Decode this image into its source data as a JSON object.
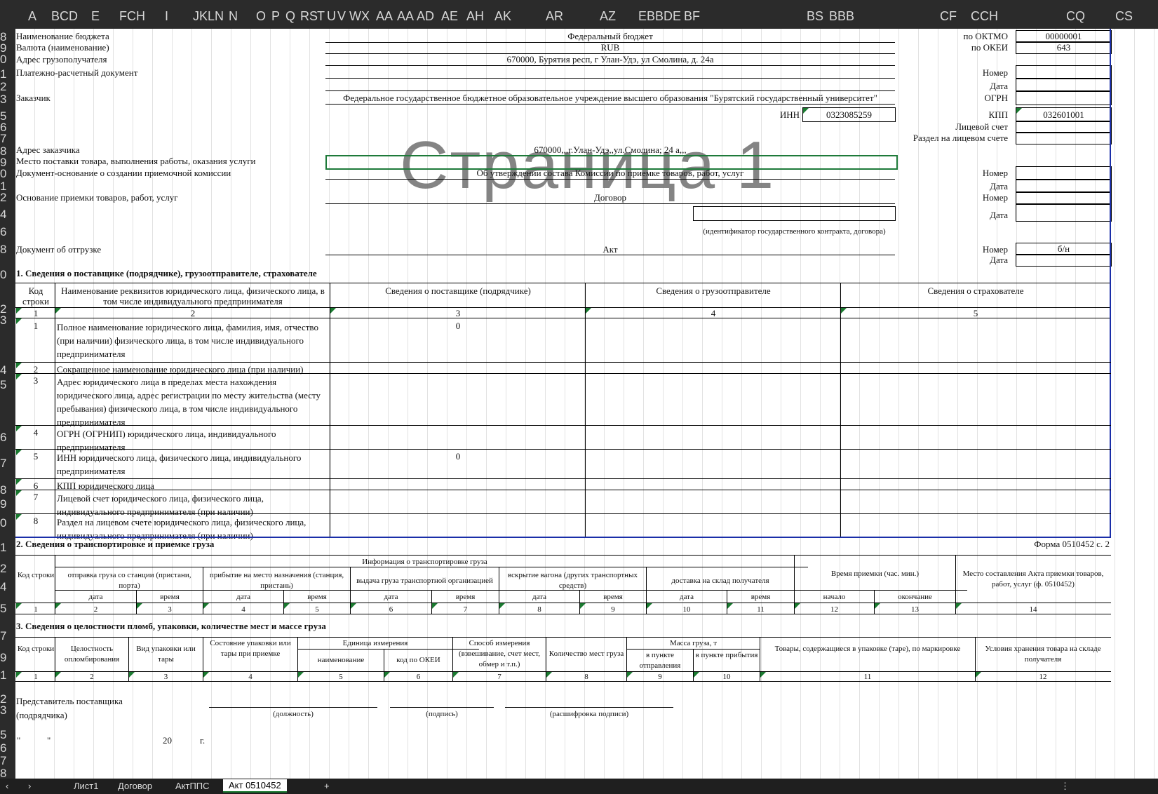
{
  "column_headers": [
    "A",
    "BCD",
    "E",
    "FCH",
    "I",
    "JKLN",
    "N",
    "O",
    "P",
    "Q",
    "RS",
    "T",
    "U",
    "V",
    "WX",
    "AA",
    "AA",
    "AD",
    "AE",
    "AH",
    "AK",
    "AR",
    "AZ",
    "EBBDE",
    "BF",
    "BS",
    "BBB",
    "CF",
    "CCH",
    "CQ",
    "CS"
  ],
  "row_numbers": [
    "8",
    "9",
    "0",
    "1",
    "2",
    "3",
    "5",
    "6",
    "7",
    "8",
    "9",
    "0",
    "1",
    "2",
    "4",
    "6",
    "8",
    "0",
    "2",
    "3",
    "4",
    "5",
    "6",
    "7",
    "8",
    "9",
    "0",
    "1",
    "2",
    "4",
    "5",
    "7",
    "9",
    "1",
    "2",
    "3",
    "5",
    "6",
    "7",
    "8"
  ],
  "watermark": "Страница 1",
  "header": {
    "budget_label": "Наименование бюджета",
    "budget_value": "Федеральный бюджет",
    "oktmo_label": "по ОКТМО",
    "oktmo_value": "00000001",
    "currency_label": "Валюта (наименование)",
    "currency_value": "RUB",
    "okei_label": "по ОКЕИ",
    "okei_value": "643",
    "consignee_address_label": "Адрес грузополучателя",
    "consignee_address_value": "670000, Бурятия респ, г Улан-Удэ, ул Смолина, д. 24а",
    "payment_doc_label": "Платежно-расчетный документ",
    "nomer_label": "Номер",
    "data_label": "Дата",
    "customer_label": "Заказчик",
    "customer_value": "Федеральное государственное бюджетное образовательное учреждение высшего образования \"Бурятский государственный университет\"",
    "ogrn_label": "ОГРН",
    "inn_label": "ИНН",
    "inn_value": "0323085259",
    "kpp_label": "КПП",
    "kpp_value": "032601001",
    "account_label": "Лицевой счет",
    "account_section_label": "Раздел на лицевом счете",
    "customer_address_label": "Адрес заказчика",
    "customer_address_value": "670000,,,г.Улан-Удэ,,ул.Смолина; 24 а,,,",
    "delivery_place_label": "Место поставки товара, выполнения работы, оказания услуги",
    "commission_doc_label": "Документ-основание о создании приемочной комиссии",
    "commission_doc_value": "Об утверждении состава Комиссии по приемке товаров, работ, услуг",
    "basis_label": "Основание приемки товаров, работ, услуг",
    "basis_value": "Договор",
    "contract_id_caption": "(идентификатор государственного контракта, договора)",
    "shipment_doc_label": "Документ об отгрузке",
    "shipment_doc_value": "Акт",
    "shipment_nomer_value": "б/н"
  },
  "section1": {
    "title": "1. Сведения о поставщике (подрядчике), грузоотправителе, страхователе",
    "col_code": "Код строки",
    "col_name": "Наименование реквизитов юридического лица, физического лица, в том числе индивидуального предпринимателя",
    "col_supplier": "Сведения о поставщике (подрядчике)",
    "col_shipper": "Сведения о грузоотправителе",
    "col_insurer": "Сведения о страхователе",
    "col_numbers": [
      "1",
      "2",
      "3",
      "4",
      "5"
    ],
    "rows": [
      {
        "code": "1",
        "name": "Полное наименование юридического лица, фамилия, имя, отчество (при наличии) физического лица, в том числе индивидуального предпринимателя",
        "supplier": "0"
      },
      {
        "code": "2",
        "name": "Сокращенное наименование юридического лица (при наличии)",
        "supplier": ""
      },
      {
        "code": "3",
        "name": "Адрес юридического лица в пределах места нахождения юридического лица, адрес регистрации по месту жительства (месту пребывания) физического лица, в том числе индивидуального предпринимателя",
        "supplier": ""
      },
      {
        "code": "4",
        "name": "ОГРН (ОГРНИП) юридического лица, индивидуального предпринимателя",
        "supplier": ""
      },
      {
        "code": "5",
        "name": "ИНН юридического лица, физического лица, индивидуального предпринимателя",
        "supplier": "0"
      },
      {
        "code": "6",
        "name": "КПП юридического лица",
        "supplier": ""
      },
      {
        "code": "7",
        "name": "Лицевой счет юридического лица, физического лица, индивидуального предпринимателя (при наличии)",
        "supplier": ""
      },
      {
        "code": "8",
        "name": "Раздел на лицевом счете юридического лица, физического лица, индивидуального предпринимателя (при наличии)",
        "supplier": ""
      }
    ]
  },
  "section2": {
    "title": "2. Сведения о транспортировке и приемке груза",
    "form_label": "Форма 0510452 с. 2",
    "info_header": "Информация о транспортировке груза",
    "code": "Код строки",
    "groups": [
      "отправка груза со станции (пристани, порта)",
      "прибытие на место назначения (станция, пристань)",
      "выдача груза транспортной организацией",
      "вскрытие вагона (других транспортных средств)",
      "доставка на склад получателя"
    ],
    "date": "дата",
    "time": "время",
    "accept_time": "Время приемки (час. мин.)",
    "start": "начало",
    "end": "окончание",
    "place": "Место составления Акта приемки товаров, работ, услуг (ф. 0510452)",
    "numbers": [
      "1",
      "2",
      "3",
      "4",
      "5",
      "6",
      "7",
      "8",
      "9",
      "10",
      "11",
      "12",
      "13",
      "14"
    ]
  },
  "section3": {
    "title": "3. Сведения о целостности пломб, упаковки, количестве мест и массе груза",
    "code": "Код строки",
    "seal": "Целостность опломбирования",
    "pack_type": "Вид упаковки или тары",
    "pack_state": "Состояние упаковки или тары при приемке",
    "unit": "Единица измерения",
    "unit_name": "наименование",
    "unit_okei": "код по ОКЕИ",
    "method": "Способ измерения (взвешивание, счет мест, обмер и т.п.)",
    "places": "Количество мест груза",
    "mass": "Масса груза, т",
    "mass_from": "в пункте отправления",
    "mass_to": "в пункте прибытия",
    "goods": "Товары, содержащиеся в упаковке (таре), по маркировке",
    "storage": "Условия хранения товара на складе получателя",
    "numbers": [
      "1",
      "2",
      "3",
      "4",
      "5",
      "6",
      "7",
      "8",
      "9",
      "10",
      "11",
      "12"
    ]
  },
  "signature": {
    "rep_label": "Представитель поставщика",
    "rep_label2": "(подрядчика)",
    "position": "(должность)",
    "sign": "(подпись)",
    "decode": "(расшифровка подписи)",
    "date_quote": "\"",
    "date_quote2": "\"",
    "year": "20",
    "year_suffix": "г."
  },
  "tabs": [
    "Лист1",
    "Договор",
    "АктППС",
    "Акт 0510452",
    "+"
  ]
}
